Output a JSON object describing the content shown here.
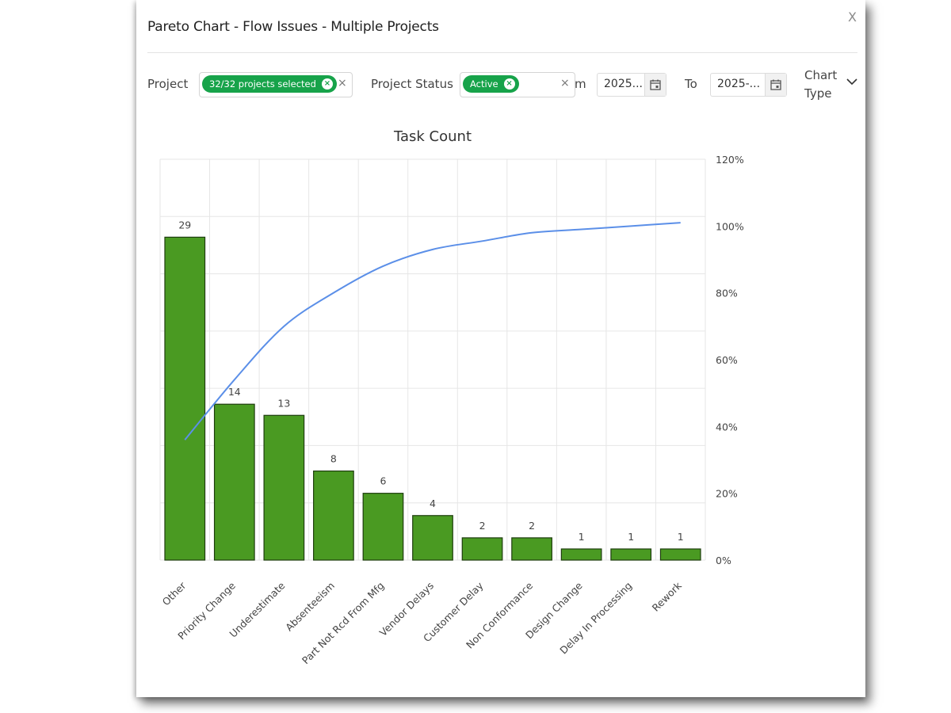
{
  "dialog": {
    "title": "Pareto Chart - Flow Issues - Multiple Projects",
    "close_label": "X"
  },
  "filters": {
    "project_label": "Project",
    "project_chip": "32/32 projects selected",
    "project_status_label": "Project Status",
    "status_chip": "Active",
    "from_label_partial": "m",
    "from_value": "2025...",
    "to_label": "To",
    "to_value": "2025-...",
    "chart_type_label_line1": "Chart",
    "chart_type_label_line2": "Type",
    "clear_glyph": "×",
    "chip_remove_glyph": "×"
  },
  "colors": {
    "bar_fill": "#4a9a22",
    "bar_stroke": "#1e3d0e",
    "line": "#5b8fe8",
    "chip": "#17a34a",
    "grid": "#e6e6e6"
  },
  "chart_data": {
    "type": "bar",
    "title": "Task Count",
    "categories": [
      "Other",
      "Priority Change",
      "Underestimate",
      "Absenteeism",
      "Part Not Rcd From Mfg",
      "Vendor Delays",
      "Customer Delay",
      "Non Conformance",
      "Design Change",
      "Delay In Processing",
      "Rework"
    ],
    "series": [
      {
        "type": "bar",
        "values": [
          29,
          14,
          13,
          8,
          6,
          4,
          2,
          2,
          1,
          1,
          1
        ]
      },
      {
        "type": "line",
        "axis": "right",
        "values": [
          36,
          54,
          70,
          80,
          88,
          93,
          95.5,
          98,
          99,
          100,
          101
        ]
      }
    ],
    "y_left": {
      "min": 0,
      "max": 36
    },
    "y_right": {
      "min": 0,
      "max": 120,
      "ticks": [
        "0%",
        "20%",
        "40%",
        "60%",
        "80%",
        "100%",
        "120%"
      ]
    },
    "grid": true
  }
}
